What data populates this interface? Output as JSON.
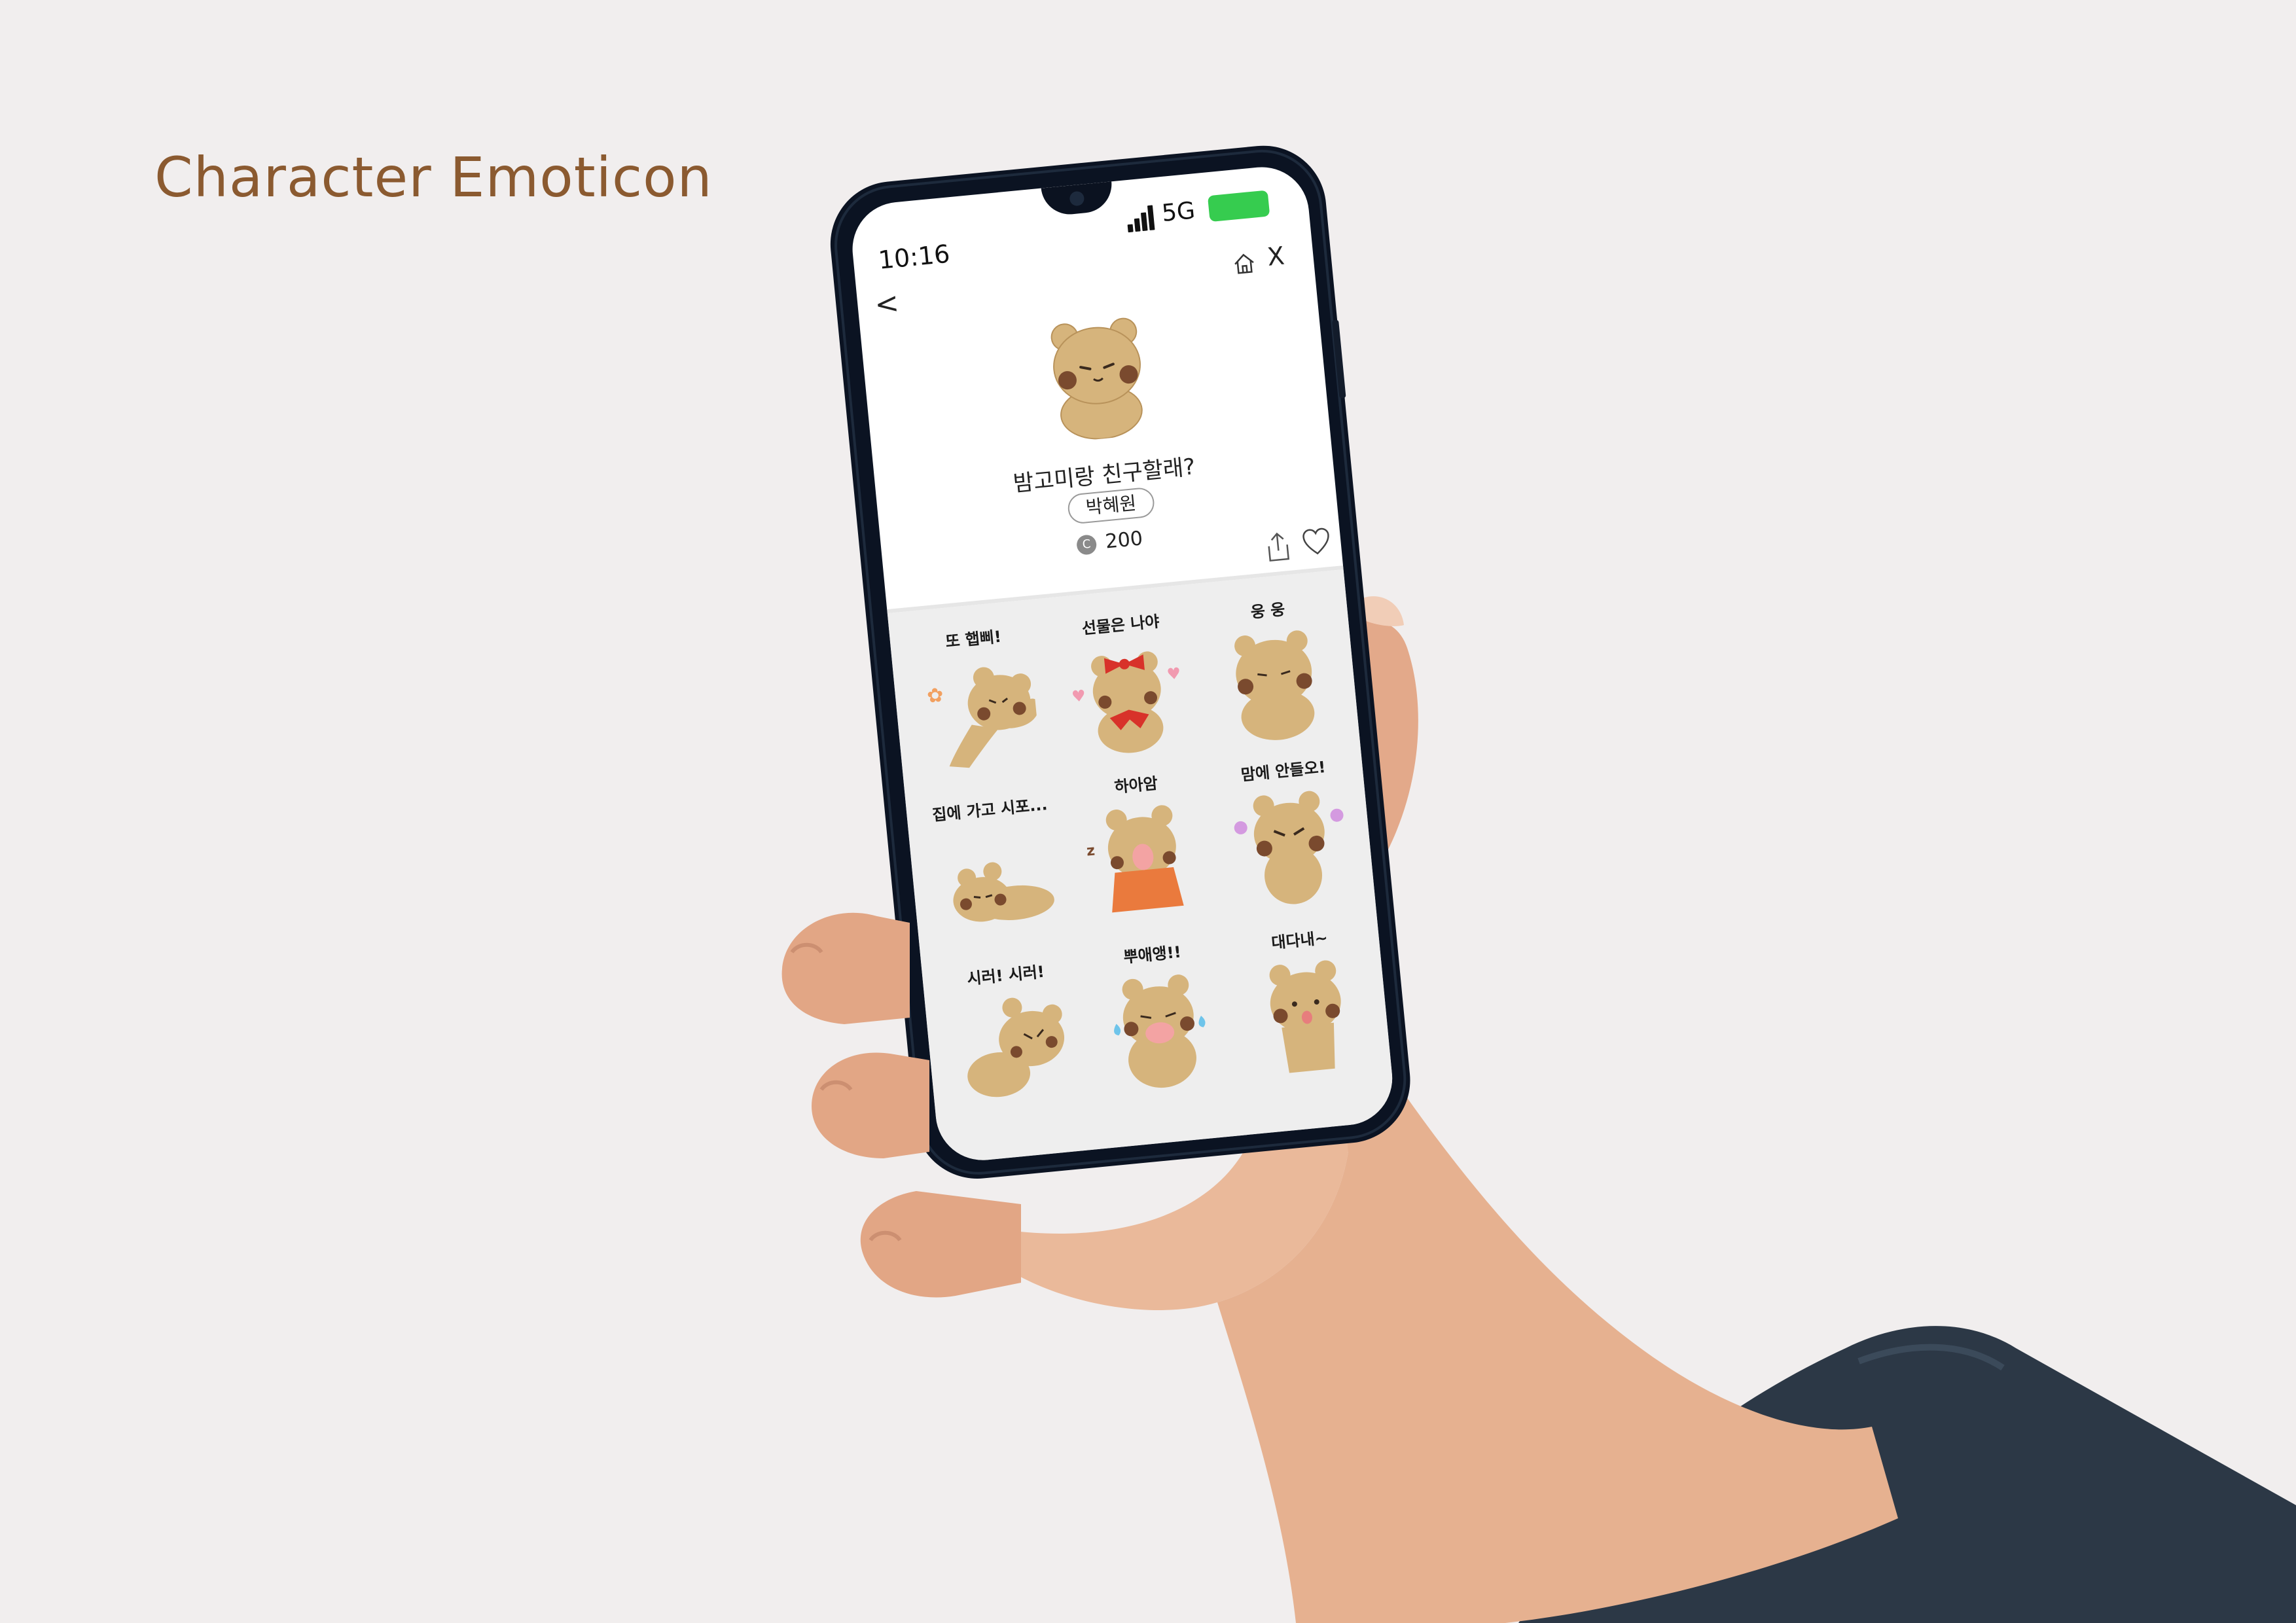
{
  "heading": "Character Emoticon",
  "colors": {
    "heading": "#8b5a30",
    "background": "#f1eeee",
    "battery": "#36cc4f",
    "bear": "#d6b47c",
    "cheek": "#7a4a2e"
  },
  "phone": {
    "status": {
      "time": "10:16",
      "network": "5G"
    },
    "icons": {
      "back": "<",
      "home": "home-icon",
      "close": "X",
      "share": "share-icon",
      "like": "heart-icon"
    },
    "pack": {
      "title": "밤고미랑 친구할래?",
      "author": "박혜원",
      "currency_symbol": "C",
      "price": "200"
    },
    "stickers": [
      {
        "caption": "또 햅삐!"
      },
      {
        "caption": "선물은 나야"
      },
      {
        "caption": "웅 웅"
      },
      {
        "caption": "집에 가고 시포..."
      },
      {
        "caption": "하아암"
      },
      {
        "caption": "맘에 안들오!"
      },
      {
        "caption": "시러! 시러!"
      },
      {
        "caption": "뿌애앵!!"
      },
      {
        "caption": "대다내~"
      }
    ]
  }
}
